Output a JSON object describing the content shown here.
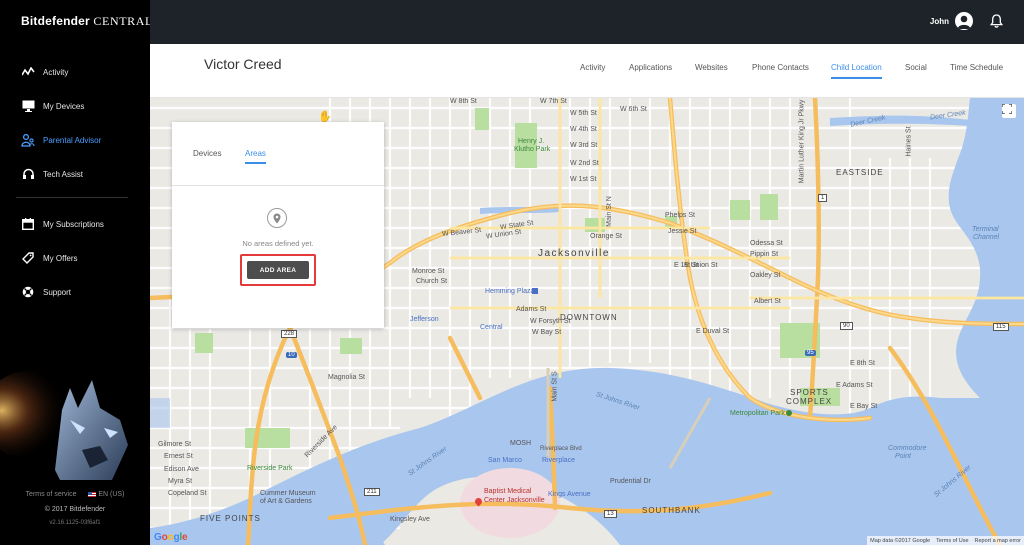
{
  "app": {
    "logo_brand": "Bitdefender",
    "logo_product": "CENTRAL"
  },
  "sidebar": {
    "items": [
      {
        "label": "Activity",
        "icon": "activity-icon"
      },
      {
        "label": "My Devices",
        "icon": "monitor-icon"
      },
      {
        "label": "Parental Advisor",
        "icon": "family-icon",
        "active": true
      },
      {
        "label": "Tech Assist",
        "icon": "headset-icon"
      },
      {
        "label": "My Subscriptions",
        "icon": "calendar-icon"
      },
      {
        "label": "My Offers",
        "icon": "tag-icon"
      },
      {
        "label": "Support",
        "icon": "lifebuoy-icon"
      }
    ],
    "footer": {
      "terms": "Terms of service",
      "language": "EN (US)",
      "copyright": "© 2017 Bitdefender",
      "version": "v2.16.1125-03f6af1"
    }
  },
  "topbar": {
    "user_name": "John"
  },
  "header": {
    "title": "Victor Creed",
    "tabs": [
      {
        "label": "Activity"
      },
      {
        "label": "Applications"
      },
      {
        "label": "Websites"
      },
      {
        "label": "Phone Contacts"
      },
      {
        "label": "Child Location",
        "active": true
      },
      {
        "label": "Social"
      },
      {
        "label": "Time Schedule"
      }
    ]
  },
  "panel": {
    "tabs": [
      {
        "label": "Devices"
      },
      {
        "label": "Areas",
        "active": true
      }
    ],
    "empty_message": "No areas defined yet.",
    "add_area_label": "ADD AREA"
  },
  "map": {
    "labels": {
      "city": "Jacksonville",
      "downtown": "DOWNTOWN",
      "eastside": "EASTSIDE",
      "sports_complex_1": "SPORTS",
      "sports_complex_2": "COMPLEX",
      "five_points": "FIVE POINTS",
      "southbank": "SOUTHBANK",
      "riverside_park": "Riverside Park",
      "hemming_plaza": "Hemming Plaza",
      "jefferson": "Jefferson",
      "central": "Central",
      "metropolitan_park": "Metropolitan Park",
      "commodore_point_1": "Commodore",
      "commodore_point_2": "Point",
      "mosh": "MOSH",
      "riverplace_blvd": "Riverplace Blvd",
      "san_marco": "San Marco",
      "riverplace": "Riverplace",
      "kings_avenue": "Kings Avenue",
      "baptist_1": "Baptist Medical",
      "baptist_2": "Center Jacksonville",
      "cummer_1": "Cummer Museum",
      "cummer_2": "of Art & Gardens",
      "st_johns_river_1": "St Johns River",
      "st_johns_river_2": "St Johns River",
      "st_johns_river_3": "St Johns River",
      "terminal_channel_1": "Terminal",
      "terminal_channel_2": "Channel",
      "deer_creek_1": "Deer Creek",
      "deer_creek_2": "Deer Creek",
      "henry_park_1": "Henry J.",
      "henry_park_2": "Klutho Park",
      "w_state_st": "W State St",
      "w_union_st": "W Union St",
      "w_beaver_st": "W Beaver St",
      "w_forsyth_st": "W Forsyth St",
      "w_bay_st": "W Bay St",
      "adams_st": "Adams St",
      "e_duval_st": "E Duval St",
      "main_st_n": "Main St N",
      "e_union_st": "E Union St",
      "phelps_st": "Phelps St",
      "jessie_st": "Jessie St",
      "odessa_st": "Odessa St",
      "pippin_st": "Pippin St",
      "oakley_st": "Oakley St",
      "albert_st": "Albert St",
      "orange_st": "Orange St",
      "w_1st_st": "W 1st St",
      "w_2nd_st": "W 2nd St",
      "w_3rd_st": "W 3rd St",
      "w_4th_st": "W 4th St",
      "w_5th_st": "W 5th St",
      "w_6th_st": "W 6th St",
      "w_7th_st": "W 7th St",
      "w_8th_st": "W 8th St",
      "magnolia_st": "Magnolia St",
      "riverside_ave": "Riverside Ave",
      "gilmore_st": "Gilmore St",
      "edison_ave": "Edison Ave",
      "ernest_st": "Ernest St",
      "myra_st": "Myra St",
      "copeland_st": "Copeland St",
      "kingsley_ave": "Kingsley Ave",
      "prudential_dr": "Prudential Dr",
      "monroe_st": "Monroe St",
      "church_st": "Church St",
      "e_1st_st": "E 1st St",
      "e_8th_st": "E 8th St",
      "main_st_s": "Main St S",
      "mlk_pkwy": "Martin Luther King Jr Pkwy",
      "haines_st": "Haines St",
      "e_adams_st": "E Adams St",
      "e_bay_st": "E Bay St",
      "i95": "95",
      "i10": "10",
      "us1": "1",
      "r90": "90",
      "r115": "115",
      "r228": "228",
      "r211": "211",
      "r13": "13"
    },
    "footer": {
      "map_data": "Map data ©2017 Google",
      "terms": "Terms of Use",
      "report": "Report a map error"
    },
    "google_letters": [
      "G",
      "o",
      "o",
      "g",
      "l",
      "e"
    ]
  },
  "colors": {
    "accent": "#3b8ee8",
    "highlight_box": "#e43a3a",
    "button_bg": "#4d4d4d",
    "water": "#a9c6ee",
    "park": "#b8dea0",
    "highway": "#f6bd5e"
  }
}
